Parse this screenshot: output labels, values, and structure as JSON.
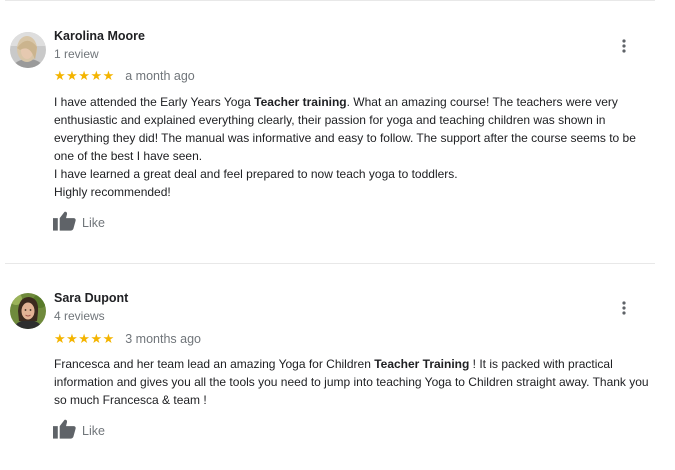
{
  "reviews": [
    {
      "name": "Karolina Moore",
      "count": "1 review",
      "stars": "★★★★★",
      "date": "a month ago",
      "text_parts": [
        "I have attended the Early Years Yoga ",
        "Teacher training",
        ". What an amazing course! The teachers were very enthusiastic and explained everything clearly, their passion for yoga and teaching children was shown in everything they did! The manual was informative and easy to follow. The support after the course seems to be one of the best I have seen.",
        "I have learned a great deal and feel prepared to now teach yoga to toddlers.",
        "Highly recommended!"
      ],
      "like_label": "Like",
      "icons": {
        "menu": "more-vert-icon",
        "like": "thumbs-up-icon"
      }
    },
    {
      "name": "Sara Dupont",
      "count": "4 reviews",
      "stars": "★★★★★",
      "date": "3 months ago",
      "text_parts": [
        "Francesca and her team lead an amazing Yoga for Children ",
        "Teacher Training",
        " ! It is packed with practical information and gives you all the tools you need to jump into teaching Yoga to Children straight away. Thank you so much Francesca & team !"
      ],
      "like_label": "Like",
      "icons": {
        "menu": "more-vert-icon",
        "like": "thumbs-up-icon"
      }
    }
  ],
  "colors": {
    "star": "#f4b400",
    "primary_text": "#202124",
    "secondary_text": "#70757a",
    "icon": "#5f6368",
    "divider": "#e8e8e8"
  }
}
